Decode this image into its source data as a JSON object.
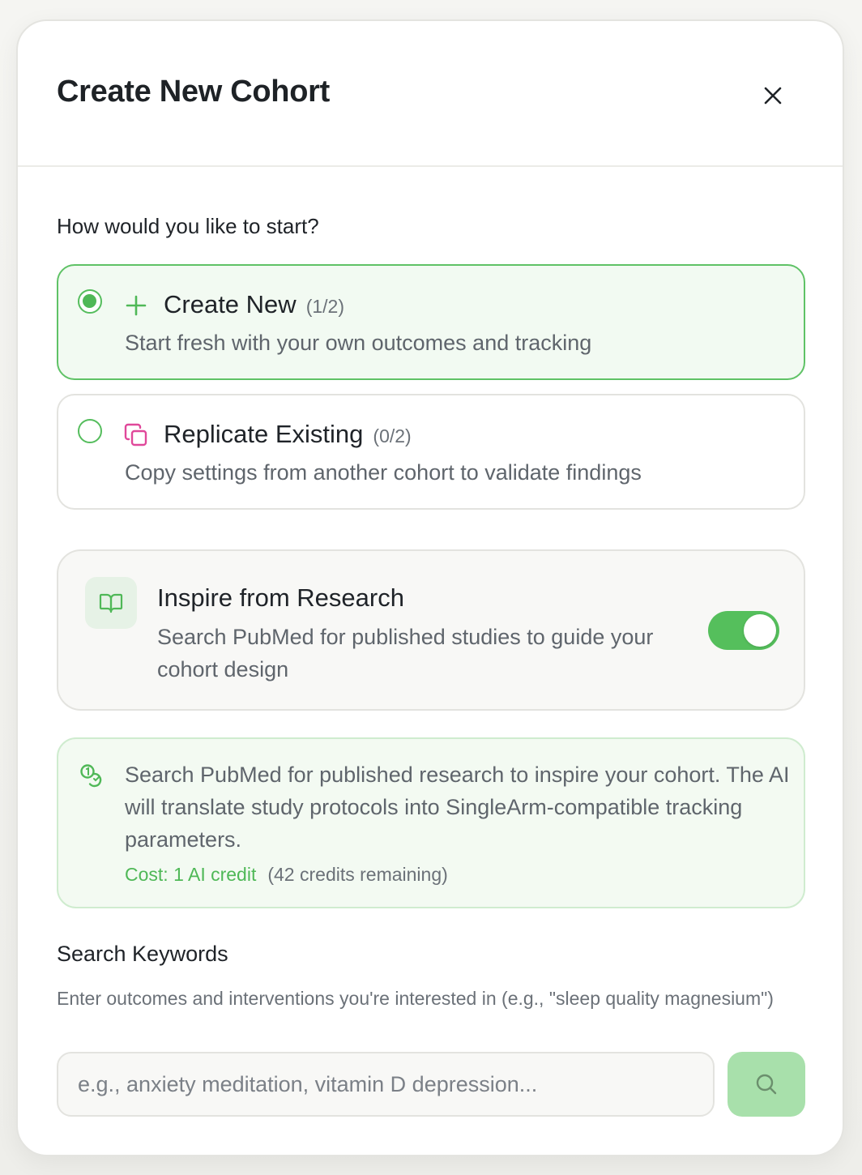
{
  "modal": {
    "title": "Create New Cohort",
    "close_icon": "close-icon"
  },
  "start": {
    "label": "How would you like to start?",
    "options": [
      {
        "title": "Create New",
        "count": "(1/2)",
        "description": "Start fresh with your own outcomes and tracking",
        "icon": "plus-icon",
        "selected": true
      },
      {
        "title": "Replicate Existing",
        "count": "(0/2)",
        "description": "Copy settings from another cohort to validate findings",
        "icon": "copy-icon",
        "selected": false
      }
    ]
  },
  "inspire": {
    "title": "Inspire from Research",
    "description": "Search PubMed for published studies to guide your cohort design",
    "icon": "book-icon",
    "enabled": true
  },
  "info": {
    "text": "Search PubMed for published research to inspire your cohort. The AI will translate study protocols into SingleArm-compatible tracking parameters.",
    "cost": "Cost: 1 AI credit",
    "remaining": "(42 credits remaining)",
    "icon": "credits-icon"
  },
  "keywords": {
    "label": "Search Keywords",
    "help": "Enter outcomes and interventions you're interested in (e.g., \"sleep quality magnesium\")",
    "placeholder": "e.g., anxiety meditation, vitamin D depression...",
    "value": "",
    "button_icon": "search-icon"
  },
  "colors": {
    "accent_green": "#55bf5c",
    "pink_accent": "#e0489a",
    "search_button": "#a8e0ab"
  }
}
